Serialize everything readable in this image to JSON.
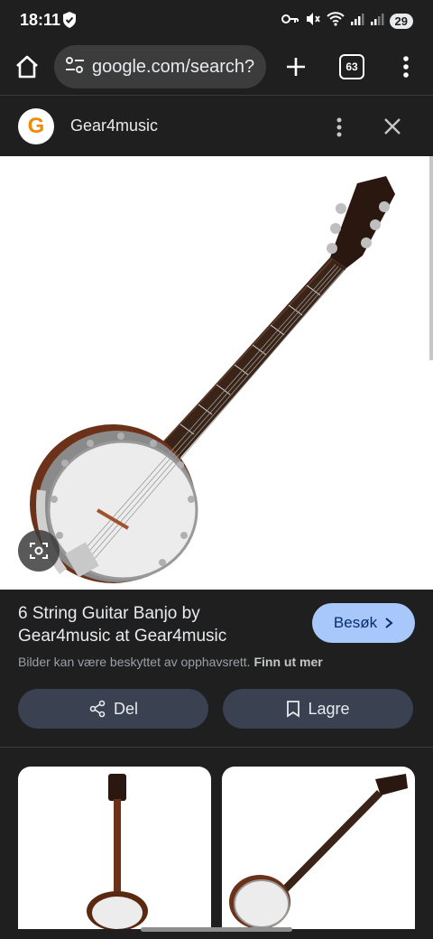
{
  "status": {
    "time": "18:11",
    "battery": "29",
    "icons": [
      "vpn-shield-icon",
      "key-icon",
      "mute-icon",
      "wifi-icon",
      "signal-icon",
      "signal-icon",
      "battery-icon"
    ]
  },
  "browser": {
    "url": "google.com/search?",
    "tab_count": "63",
    "icons": [
      "home-icon",
      "site-settings-icon",
      "plus-icon",
      "menu-dots-icon"
    ]
  },
  "source": {
    "logo_letter": "G",
    "name": "Gear4music",
    "icons": [
      "more-vert-icon",
      "close-icon"
    ],
    "logo_color": "#f08a00"
  },
  "result": {
    "title": "6 String Guitar Banjo by Gear4music at Gear4music",
    "visit_label": "Besøk",
    "copyright_text": "Bilder kan være beskyttet av opphavsrett.",
    "learn_more": "Finn ut mer",
    "share_label": "Del",
    "save_label": "Lagre",
    "accent_color": "#a8c7fa"
  }
}
